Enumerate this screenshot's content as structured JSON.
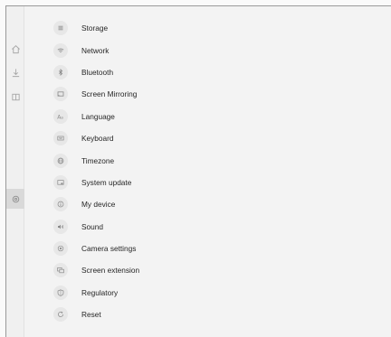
{
  "sidebar": {
    "items": [
      {
        "icon": "home-icon",
        "active": false
      },
      {
        "icon": "download-icon",
        "active": false
      },
      {
        "icon": "split-view-icon",
        "active": false
      },
      {
        "icon": "settings-gear-icon",
        "active": true
      }
    ]
  },
  "menu": {
    "items": [
      {
        "label": "Storage",
        "icon": "storage-icon"
      },
      {
        "label": "Network",
        "icon": "wifi-icon"
      },
      {
        "label": "Bluetooth",
        "icon": "bluetooth-icon"
      },
      {
        "label": "Screen Mirroring",
        "icon": "screen-mirroring-icon"
      },
      {
        "label": "Language",
        "icon": "language-icon"
      },
      {
        "label": "Keyboard",
        "icon": "keyboard-icon"
      },
      {
        "label": "Timezone",
        "icon": "globe-icon"
      },
      {
        "label": "System update",
        "icon": "system-update-icon"
      },
      {
        "label": "My device",
        "icon": "info-icon"
      },
      {
        "label": "Sound",
        "icon": "speaker-icon"
      },
      {
        "label": "Camera settings",
        "icon": "camera-icon"
      },
      {
        "label": "Screen extension",
        "icon": "screen-extension-icon"
      },
      {
        "label": "Regulatory",
        "icon": "shield-icon"
      },
      {
        "label": "Reset",
        "icon": "reset-icon"
      }
    ]
  }
}
